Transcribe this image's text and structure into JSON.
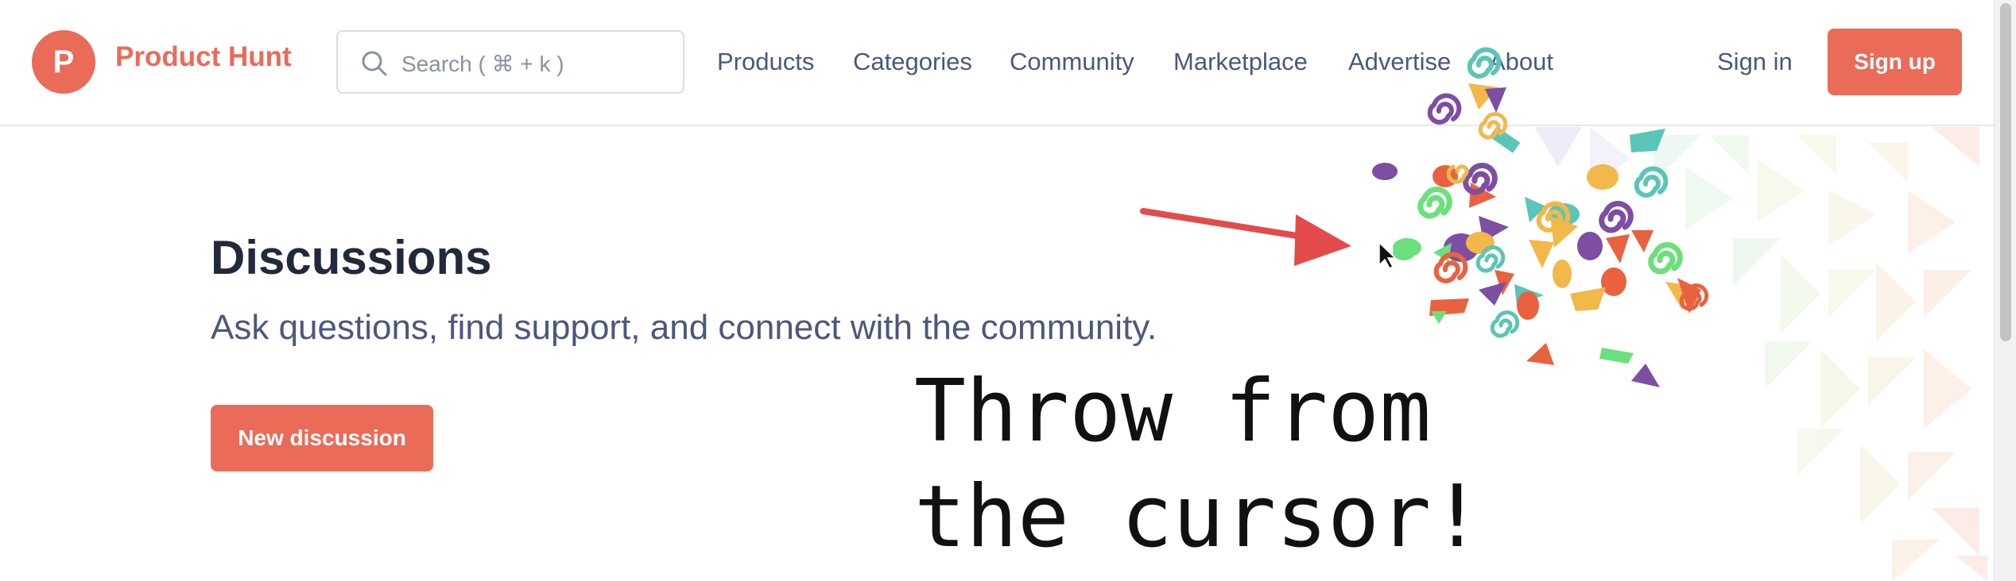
{
  "header": {
    "brand": "Product Hunt",
    "logo_letter": "P",
    "search_placeholder": "Search ( ⌘ + k )",
    "nav": [
      "Products",
      "Categories",
      "Community",
      "Marketplace",
      "Advertise",
      "About"
    ],
    "sign_in": "Sign in",
    "sign_up": "Sign up"
  },
  "main": {
    "title": "Discussions",
    "subtitle": "Ask questions, find support, and connect with the community.",
    "new_discussion": "New discussion"
  },
  "annotation": {
    "line1": "Throw from",
    "line2": "the cursor!"
  },
  "colors": {
    "brand": "#ea6b58",
    "text_dark": "#21293c",
    "text_muted": "#4b587c",
    "arrow": "#e34b4b",
    "confetti": [
      "#7d4ea2",
      "#5bc5b7",
      "#f2b84a",
      "#e8623f",
      "#6ce07d"
    ]
  }
}
